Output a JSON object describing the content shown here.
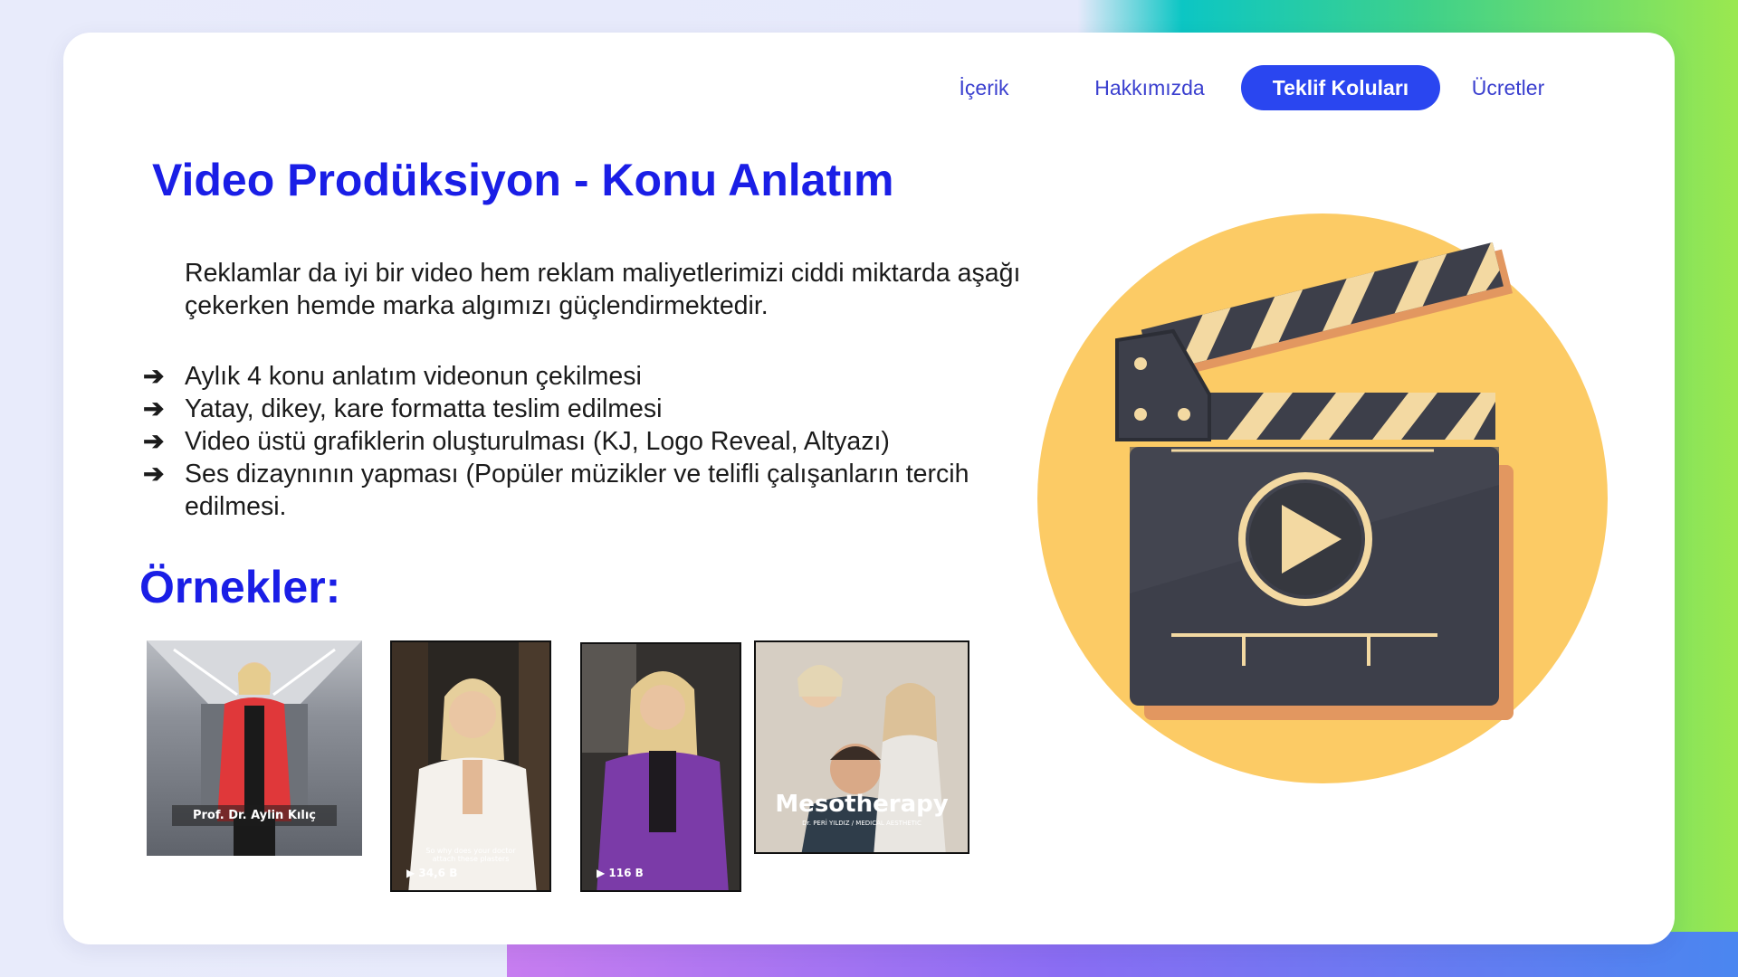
{
  "nav": {
    "items": [
      {
        "label": "İçerik",
        "active": false
      },
      {
        "label": "Hakkımızda",
        "active": false
      },
      {
        "label": "Teklif Koluları",
        "active": true
      },
      {
        "label": "Ücretler",
        "active": false
      }
    ]
  },
  "main": {
    "title": "Video Prodüksiyon - Konu Anlatım",
    "intro": "Reklamlar da iyi bir video hem reklam maliyetlerimizi ciddi miktarda aşağı çekerken hemde marka algımızı güçlendirmektedir.",
    "bullets": [
      "Aylık 4 konu anlatım videonun çekilmesi",
      "Yatay, dikey, kare formatta teslim edilmesi",
      "Video üstü grafiklerin oluşturulması (KJ, Logo Reveal, Altyazı)",
      "Ses dizaynının yapması (Popüler müzikler ve telifli çalışanların tercih edilmesi."
    ],
    "bullet_icon": "arrow-right-icon",
    "examples_heading": "Örnekler:"
  },
  "examples": {
    "thumbs": [
      {
        "caption": "Prof. Dr. Aylin Kılıç"
      },
      {
        "subtitle": "So why does your doctor attach these plasters",
        "views": "34,6 B"
      },
      {
        "views": "116 B"
      },
      {
        "caption": "Mesotherapy",
        "subcaption": "Dr. PERİ YILDIZ / MEDICAL AESTHETIC"
      }
    ]
  },
  "illustration": {
    "icon": "clapperboard-play-icon"
  },
  "colors": {
    "accent": "#1a1ee6",
    "nav_active": "#2a46f0",
    "circle": "#fccb65",
    "board": "#3d3f4a"
  }
}
